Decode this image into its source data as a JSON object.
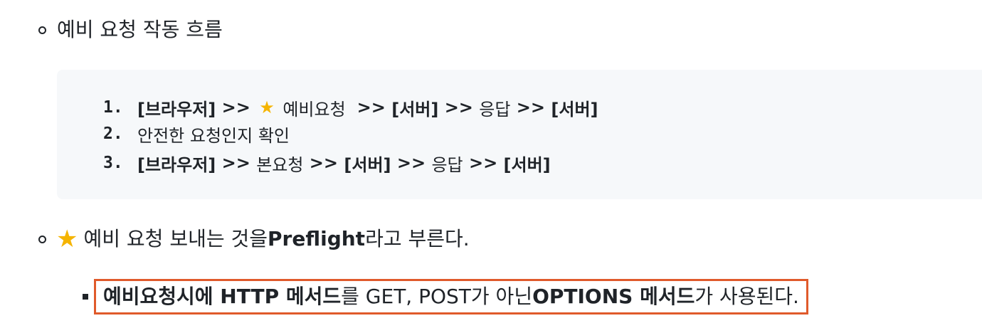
{
  "section": {
    "bullet1": "예비 요청 작동 흐름",
    "code_lines": [
      {
        "num": "1.",
        "parts": {
          "browser": "[브라우저]",
          "sep1": " >> ",
          "star": "★",
          "preflight": " 예비요청 ",
          "sep2": " >> ",
          "server1": "[서버]",
          "sep3": " >> ",
          "response": "응답",
          "sep4": " >> ",
          "server2": "[서버]"
        }
      },
      {
        "num": "2.",
        "text": "안전한 요청인지 확인"
      },
      {
        "num": "3.",
        "parts": {
          "browser": "[브라우저]",
          "sep1": " >> ",
          "main": "본요청",
          "sep2": " >> ",
          "server1": "[서버]",
          "sep3": " >> ",
          "response": "응답",
          "sep4": " >> ",
          "server2": "[서버]"
        }
      }
    ],
    "bullet2": {
      "star": "★",
      "text_before": "예비 요청 보내는 것을 ",
      "bold": "Preflight",
      "text_after": " 라고 부른다."
    },
    "bullet3": {
      "bold1": "예비요청시에 HTTP 메서드",
      "text1": "를 GET, POST가 아닌 ",
      "bold2": "OPTIONS 메서드",
      "text2": "가 사용된다."
    }
  },
  "colors": {
    "highlight_border": "#e05a2b",
    "code_background": "#f6f8fa",
    "star": "#f5b400"
  }
}
